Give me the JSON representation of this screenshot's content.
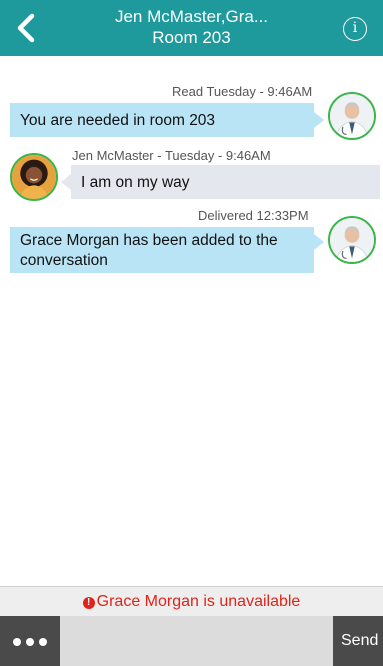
{
  "header": {
    "title_line1": "Jen McMaster,Gra...",
    "title_line2": "Room 203",
    "back_icon": "chevron-left-icon",
    "info_icon": "info-icon",
    "info_glyph": "i",
    "color": "#1e9a9c"
  },
  "messages": [
    {
      "direction": "outgoing",
      "meta": "Read Tuesday - 9:46AM",
      "text": "You are needed in room 203",
      "avatar": "doctor-avatar"
    },
    {
      "direction": "incoming",
      "meta": "Jen McMaster - Tuesday - 9:46AM",
      "text": "I am on my way",
      "avatar": "jen-avatar"
    },
    {
      "direction": "outgoing",
      "meta": "Delivered 12:33PM",
      "text": "Grace Morgan has been added to the conversation",
      "avatar": "doctor-avatar"
    }
  ],
  "status": {
    "text": "Grace Morgan is unavailable",
    "icon": "alert-icon",
    "icon_glyph": "!",
    "color": "#e2231a"
  },
  "composer": {
    "more_icon": "more-dots-icon",
    "input_value": "",
    "send_label": "Send"
  },
  "colors": {
    "outgoing_bubble": "#b9e4f5",
    "incoming_bubble": "#e4e7ee",
    "avatar_ring": "#3bb54a"
  }
}
